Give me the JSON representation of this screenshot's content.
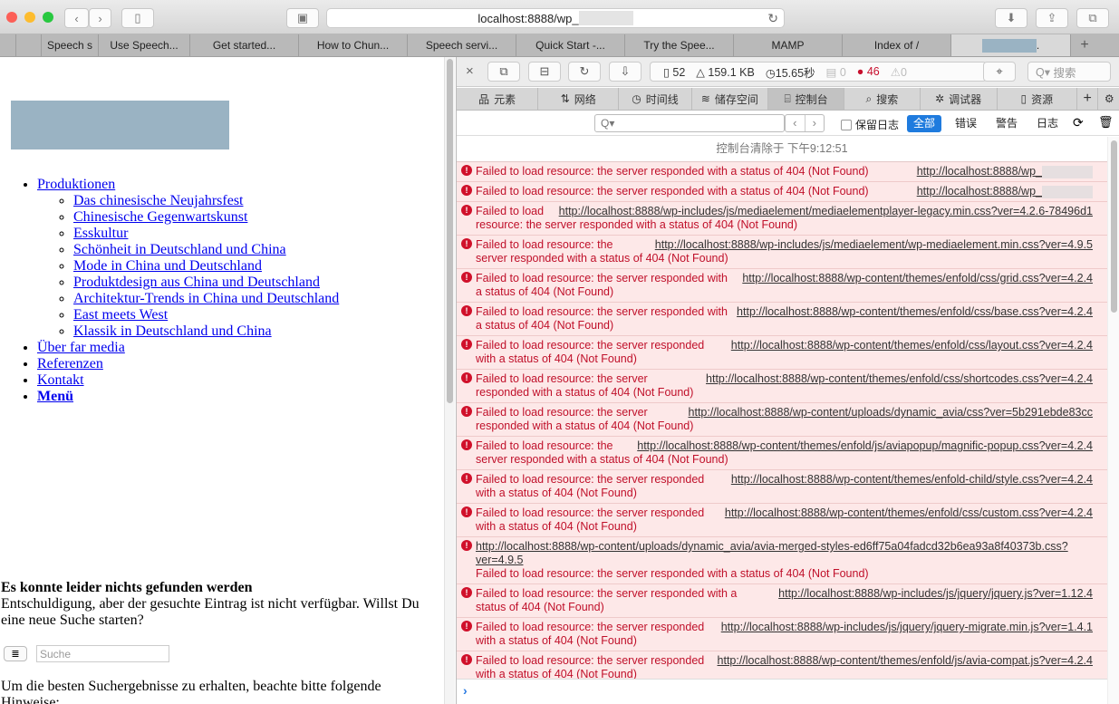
{
  "browser": {
    "url_prefix": "localhost:8888/wp_",
    "tabs": [
      "",
      "Speech s",
      "Use Speech...",
      "Get started...",
      "How to Chun...",
      "Speech servi...",
      "Quick Start -...",
      "Try the Spee...",
      "MAMP",
      "Index of /",
      "."
    ],
    "new_tab": "+"
  },
  "page": {
    "nav": [
      {
        "label": "Produktionen",
        "children": [
          "Das chinesische Neujahrsfest",
          "Chinesische Gegenwartskunst",
          "Esskultur",
          "Schönheit in Deutschland und China",
          "Mode in China und Deutschland",
          "Produktdesign aus China und Deutschland",
          "Architektur-Trends in China und Deutschland",
          "East meets West",
          "Klassik in Deutschland und China"
        ]
      },
      {
        "label": "Über far media"
      },
      {
        "label": "Referenzen"
      },
      {
        "label": "Kontakt"
      },
      {
        "label": "Menü"
      }
    ],
    "notfound_title": "Es konnte leider nichts gefunden werden",
    "notfound_text": "Entschuldigung, aber der gesuchte Eintrag ist nicht verfügbar. Willst Du eine neue Suche starten?",
    "search_placeholder": "Suche",
    "hint": "Um die besten Suchergebnisse zu erhalten, beachte bitte folgende Hinweise:"
  },
  "devtools": {
    "stats": {
      "resources": "52",
      "size": "159.1 KB",
      "time": "15.65秒",
      "logs": "0",
      "errors": "46",
      "warnings": "0"
    },
    "search_placeholder": "搜索",
    "tabs": [
      "元素",
      "网络",
      "时间线",
      "储存空间",
      "控制台",
      "搜索",
      "调试器",
      "资源"
    ],
    "filter": {
      "preserve_log": "保留日志",
      "levels": [
        "全部",
        "错误",
        "警告",
        "日志"
      ]
    },
    "cleared": "控制台清除于 下午9:12:51",
    "messages": [
      {
        "text": "Failed to load resource: the server responded with a status of 404 (Not Found)",
        "url": "http://localhost:8888/wp_"
      },
      {
        "text": "Failed to load resource: the server responded with a status of 404 (Not Found)",
        "url": "http://localhost:8888/wp_"
      },
      {
        "text": "Failed to load resource: the server responded with a status of 404 (Not Found)",
        "url": "http://localhost:8888/wp-includes/js/mediaelement/mediaelementplayer-legacy.min.css?ver=4.2.6-78496d1"
      },
      {
        "text": "Failed to load resource: the server responded with a status of 404 (Not Found)",
        "url": "http://localhost:8888/wp-includes/js/mediaelement/wp-mediaelement.min.css?ver=4.9.5"
      },
      {
        "text": "Failed to load resource: the server responded with a status of 404 (Not Found)",
        "url": "http://localhost:8888/wp-content/themes/enfold/css/grid.css?ver=4.2.4"
      },
      {
        "text": "Failed to load resource: the server responded with a status of 404 (Not Found)",
        "url": "http://localhost:8888/wp-content/themes/enfold/css/base.css?ver=4.2.4"
      },
      {
        "text": "Failed to load resource: the server responded with a status of 404 (Not Found)",
        "url": "http://localhost:8888/wp-content/themes/enfold/css/layout.css?ver=4.2.4"
      },
      {
        "text": "Failed to load resource: the server responded with a status of 404 (Not Found)",
        "url": "http://localhost:8888/wp-content/themes/enfold/css/shortcodes.css?ver=4.2.4"
      },
      {
        "text": "Failed to load resource: the server responded with a status of 404 (Not Found)",
        "url": "http://localhost:8888/wp-content/uploads/dynamic_avia/css?ver=5b291ebde83cc"
      },
      {
        "text": "Failed to load resource: the server responded with a status of 404 (Not Found)",
        "url": "http://localhost:8888/wp-content/themes/enfold/js/aviapopup/magnific-popup.css?ver=4.2.4"
      },
      {
        "text": "Failed to load resource: the server responded with a status of 404 (Not Found)",
        "url": "http://localhost:8888/wp-content/themes/enfold-child/style.css?ver=4.2.4"
      },
      {
        "text": "Failed to load resource: the server responded with a status of 404 (Not Found)",
        "url": "http://localhost:8888/wp-content/themes/enfold/css/custom.css?ver=4.2.4"
      },
      {
        "text": "Failed to load resource: the server responded with a status of 404 (Not Found)",
        "url": "http://localhost:8888/wp-content/uploads/dynamic_avia/avia-merged-styles-ed6ff75a04fadcd32b6ea93a8f40373b.css?ver=4.9.5",
        "block": true
      },
      {
        "text": "Failed to load resource: the server responded with a status of 404 (Not Found)",
        "url": "http://localhost:8888/wp-includes/js/jquery/jquery.js?ver=1.12.4"
      },
      {
        "text": "Failed to load resource: the server responded with a status of 404 (Not Found)",
        "url": "http://localhost:8888/wp-includes/js/jquery/jquery-migrate.min.js?ver=1.4.1"
      },
      {
        "text": "Failed to load resource: the server responded with a status of 404 (Not Found)",
        "url": "http://localhost:8888/wp-content/themes/enfold/js/avia-compat.js?ver=4.2.4"
      }
    ],
    "prompt": "›"
  }
}
